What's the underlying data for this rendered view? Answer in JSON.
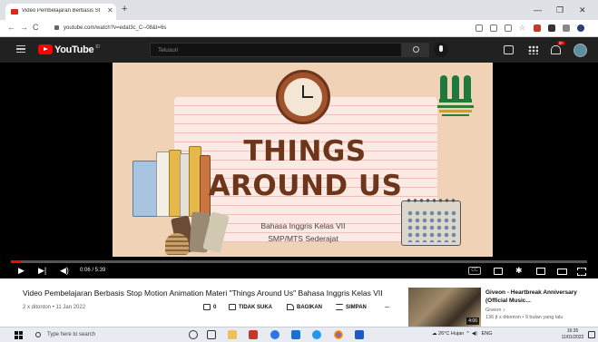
{
  "browser": {
    "tab_title": "Video Pembelajaran Berbasis St",
    "tab_close": "✕",
    "new_tab": "+",
    "url": "youtube.com/watch?v=edaI3c_C--08&t=6s",
    "win_min": "—",
    "win_max": "❐",
    "win_close": "✕",
    "back": "←",
    "forward": "→",
    "reload": "C"
  },
  "youtube": {
    "logo_text": "YouTube",
    "logo_sup": "ID",
    "search_placeholder": "Telusuri",
    "notif_count": "9+"
  },
  "slide": {
    "title_line1": "THINGS",
    "title_line2": "AROUND US",
    "subtitle_line1": "Bahasa Inggris Kelas VII",
    "subtitle_line2": "SMP/MTS Sederajat"
  },
  "player": {
    "time": "0:06 / 5:39",
    "progress": 0.018,
    "cc": "CC"
  },
  "video": {
    "title": "Video Pembelajaran Berbasis Stop Motion Animation Materi \"Things Around Us\" Bahasa Inggris Kelas VII",
    "meta": "2 x ditonton • 11 Jan 2022",
    "like_count": "0",
    "dislike_label": "TIDAK SUKA",
    "share_label": "BAGIKAN",
    "save_label": "SIMPAN",
    "more_label": "..."
  },
  "recommended": {
    "title": "Giveon - Heartbreak Anniversary (Official Music...",
    "channel": "Giveon ♪",
    "meta": "136 jt x ditonton • 9 bulan yang lalu",
    "duration": "4:06"
  },
  "taskbar": {
    "search_placeholder": "Type here to search",
    "weather": "26°C Hujan",
    "lang": "ENG",
    "time": "16:35",
    "date": "11/01/2022"
  }
}
